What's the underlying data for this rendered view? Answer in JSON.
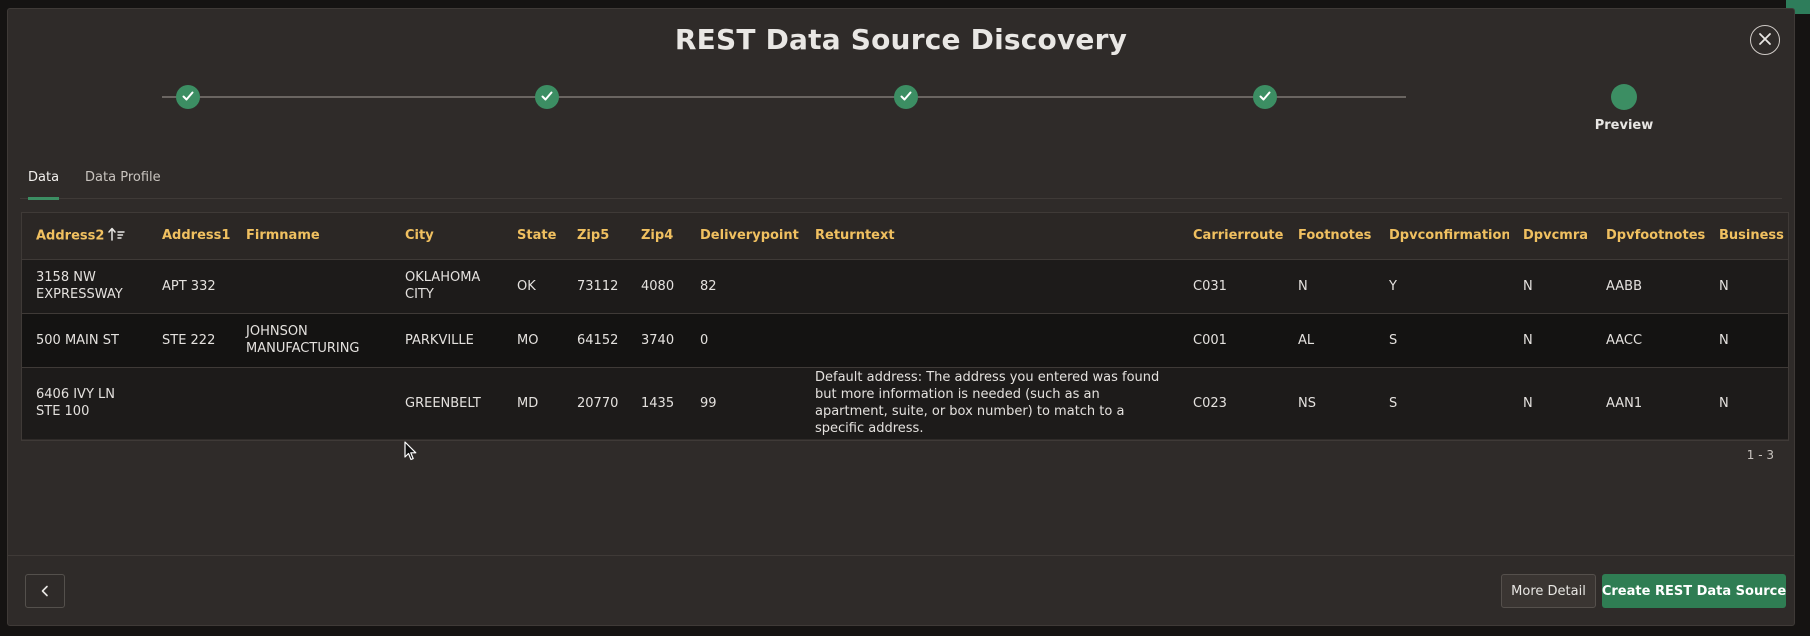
{
  "dialog": {
    "title": "REST Data Source Discovery",
    "close_icon": "close-icon"
  },
  "wizard": {
    "steps": [
      {
        "state": "complete",
        "icon": "check-icon"
      },
      {
        "state": "complete",
        "icon": "check-icon"
      },
      {
        "state": "complete",
        "icon": "check-icon"
      },
      {
        "state": "complete",
        "icon": "check-icon"
      },
      {
        "state": "current",
        "label": "Preview"
      }
    ]
  },
  "tabs": [
    {
      "label": "Data",
      "active": true
    },
    {
      "label": "Data Profile",
      "active": false
    }
  ],
  "table": {
    "columns": [
      "Address2",
      "Address1",
      "Firmname",
      "City",
      "State",
      "Zip5",
      "Zip4",
      "Deliverypoint",
      "Returntext",
      "Carrierroute",
      "Footnotes",
      "Dpvconfirmation",
      "Dpvcmra",
      "Dpvfootnotes",
      "Business"
    ],
    "sort_icon": "sort-ascending-icon",
    "rows": [
      [
        "3158 NW EXPRESSWAY",
        "APT 332",
        "",
        "OKLAHOMA CITY",
        "OK",
        "73112",
        "4080",
        "82",
        "",
        "C031",
        "N",
        "Y",
        "N",
        "AABB",
        "N"
      ],
      [
        "500 MAIN ST",
        "STE 222",
        "JOHNSON MANUFACTURING",
        "PARKVILLE",
        "MO",
        "64152",
        "3740",
        "0",
        "",
        "C001",
        "AL",
        "S",
        "N",
        "AACC",
        "N"
      ],
      [
        "6406 IVY LN STE 100",
        "",
        "",
        "GREENBELT",
        "MD",
        "20770",
        "1435",
        "99",
        "Default address: The address you entered was found but more information is needed (such as an apartment, suite, or box number) to match to a specific address.",
        "C023",
        "NS",
        "S",
        "N",
        "AAN1",
        "N"
      ]
    ],
    "pagination": "1 - 3"
  },
  "footer": {
    "back_icon": "chevron-left-icon",
    "more_detail_label": "More Detail",
    "create_label": "Create REST Data Source"
  },
  "colors": {
    "accent": "#3c8e63",
    "header_text": "#f0c060",
    "dialog_bg": "#2f2b29"
  }
}
